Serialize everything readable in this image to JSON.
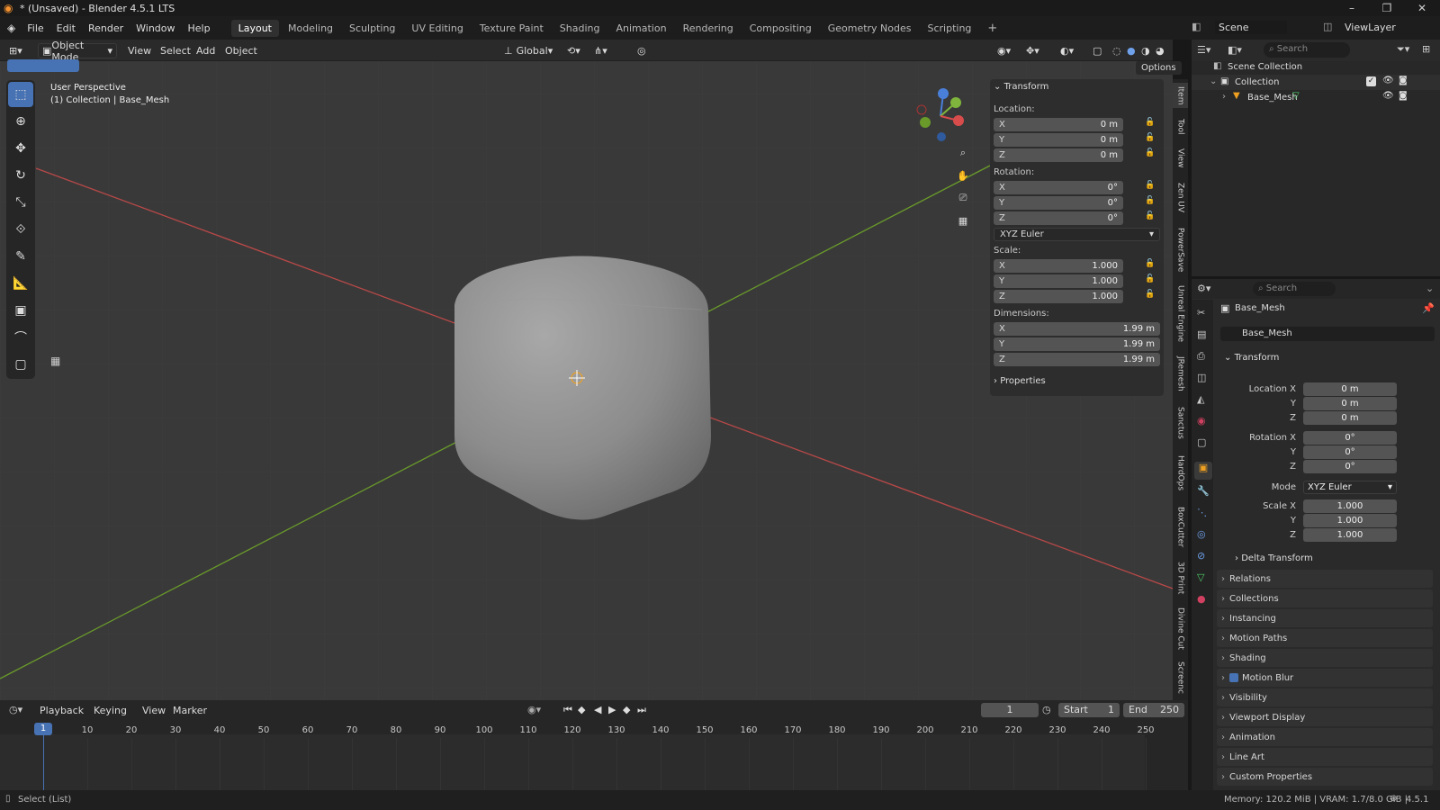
{
  "window": {
    "title": "* (Unsaved) - Blender 4.5.1 LTS",
    "minimize": "–",
    "maximize": "❐",
    "close": "✕"
  },
  "menu": {
    "items": [
      "File",
      "Edit",
      "Render",
      "Window",
      "Help"
    ]
  },
  "workspaces": [
    "Layout",
    "Modeling",
    "Sculpting",
    "UV Editing",
    "Texture Paint",
    "Shading",
    "Animation",
    "Rendering",
    "Compositing",
    "Geometry Nodes",
    "Scripting"
  ],
  "active_workspace": "Layout",
  "scene": {
    "label": "Scene",
    "viewlayer": "ViewLayer"
  },
  "viewport": {
    "mode": "Object Mode",
    "menus": [
      "View",
      "Select",
      "Add",
      "Object"
    ],
    "orientation": "Global",
    "options_label": "Options",
    "overlay_title": "User Perspective",
    "overlay_sub": "(1) Collection | Base_Mesh"
  },
  "npanel": {
    "header": "Transform",
    "location_label": "Location:",
    "rotation_label": "Rotation:",
    "scale_label": "Scale:",
    "dimensions_label": "Dimensions:",
    "location": [
      "0 m",
      "0 m",
      "0 m"
    ],
    "rotation": [
      "0°",
      "0°",
      "0°"
    ],
    "rotation_mode": "XYZ Euler",
    "scale": [
      "1.000",
      "1.000",
      "1.000"
    ],
    "dimensions": [
      "1.99 m",
      "1.99 m",
      "1.99 m"
    ],
    "properties_label": "Properties",
    "axis": [
      "X",
      "Y",
      "Z"
    ]
  },
  "side_tabs": [
    "Item",
    "Tool",
    "View",
    "Zen UV",
    "PowerSave",
    "Unreal Engine",
    "JRemesh",
    "Sanctus",
    "HardOps",
    "BoxCutter",
    "3D Print",
    "Divine Cut",
    "Screenc"
  ],
  "outliner": {
    "search_placeholder": "Search",
    "root": "Scene Collection",
    "collection": "Collection",
    "object": "Base_Mesh"
  },
  "properties": {
    "search_placeholder": "Search",
    "object_name": "Base_Mesh",
    "data_name": "Base_Mesh",
    "transform_label": "Transform",
    "location_x_label": "Location X",
    "rotation_x_label": "Rotation X",
    "scale_x_label": "Scale X",
    "mode_label": "Mode",
    "y_label": "Y",
    "z_label": "Z",
    "location": [
      "0 m",
      "0 m",
      "0 m"
    ],
    "rotation": [
      "0°",
      "0°",
      "0°"
    ],
    "mode": "XYZ Euler",
    "scale": [
      "1.000",
      "1.000",
      "1.000"
    ],
    "delta_label": "Delta Transform",
    "sections": [
      "Relations",
      "Collections",
      "Instancing",
      "Motion Paths",
      "Shading",
      "Motion Blur",
      "Visibility",
      "Viewport Display",
      "Animation",
      "Line Art",
      "Custom Properties"
    ]
  },
  "timeline": {
    "menus": [
      "Playback",
      "Keying",
      "View",
      "Marker"
    ],
    "current_frame": "1",
    "start_label": "Start",
    "start": "1",
    "end_label": "End",
    "end": "250",
    "ticks": [
      "10",
      "20",
      "30",
      "40",
      "50",
      "60",
      "70",
      "80",
      "90",
      "100",
      "110",
      "120",
      "130",
      "140",
      "150",
      "160",
      "170",
      "180",
      "190",
      "200",
      "210",
      "220",
      "230",
      "240",
      "250"
    ]
  },
  "status": {
    "left": "Select (List)",
    "right": "Memory: 120.2 MiB | VRAM: 1.7/8.0 GiB |",
    "version": "4.5.1"
  },
  "colors": {
    "accent": "#4772b3",
    "x_axis": "#d94c4c",
    "y_axis": "#7fb53c",
    "z_axis": "#4a7fd9"
  }
}
